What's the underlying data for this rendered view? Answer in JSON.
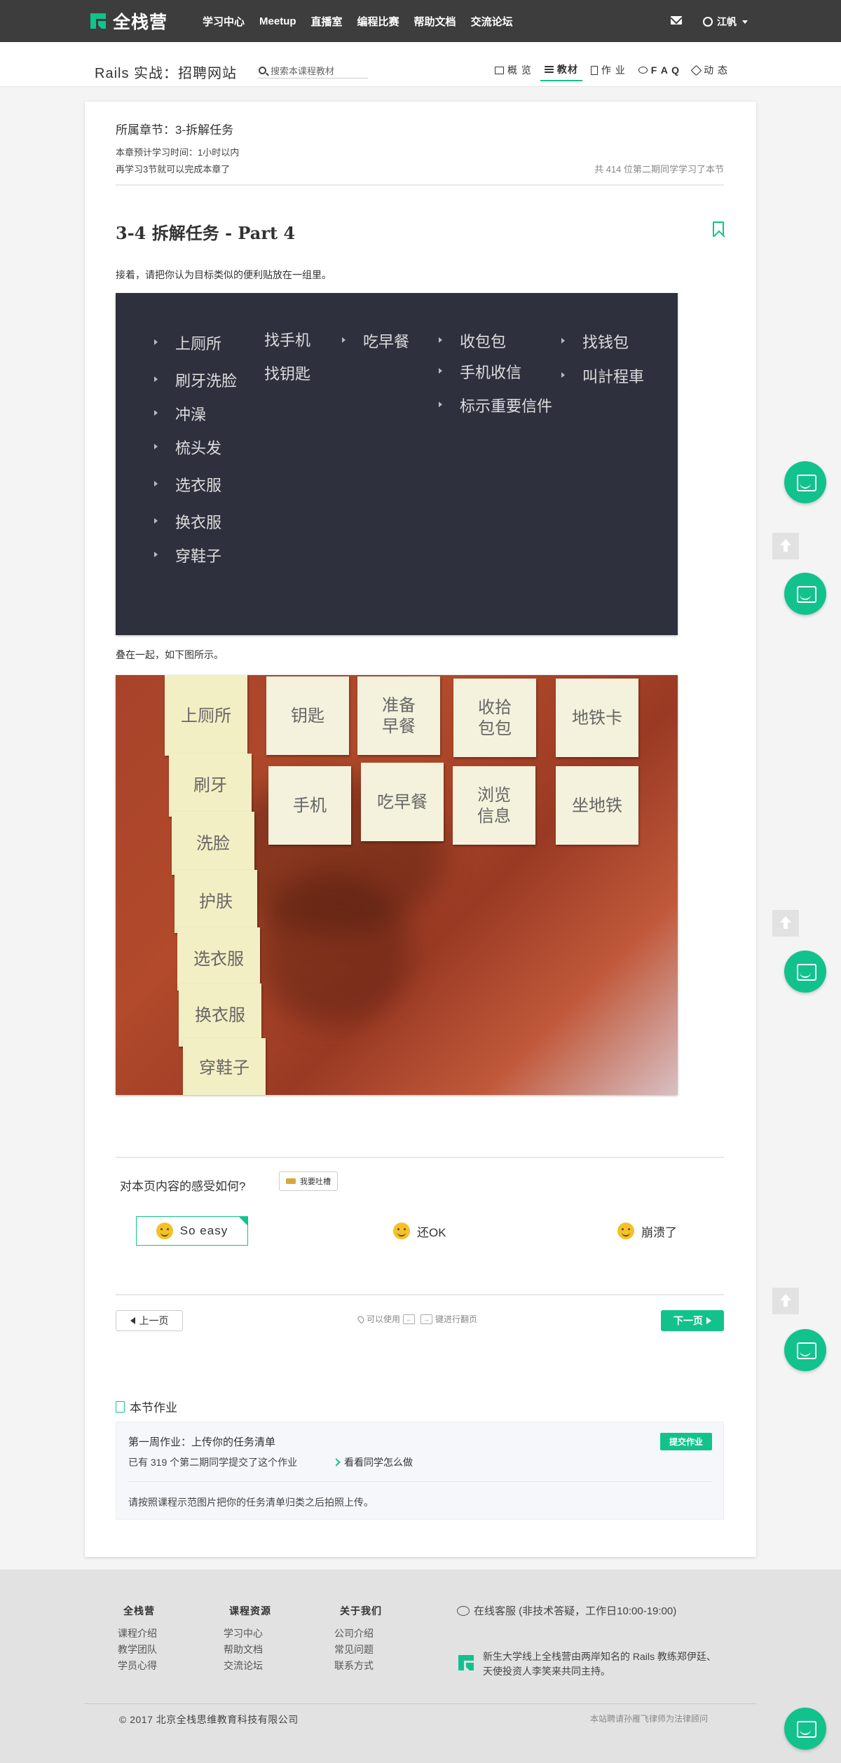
{
  "nav": {
    "brand": "全栈营",
    "links": [
      "学习中心",
      "Meetup",
      "直播室",
      "编程比赛",
      "帮助文档",
      "交流论坛"
    ],
    "user": "江帆",
    "brand_color": "#12c28d"
  },
  "course": {
    "title": "Rails 实战：招聘网站",
    "search_placeholder": "搜索本课程教材",
    "tabs": [
      "概 览",
      "教材",
      "作 业",
      "F A Q",
      "动 态"
    ],
    "active_tab": "教材"
  },
  "chapter": {
    "label": "所属章节：3-拆解任务",
    "time": "本章预计学习时间：1小时以内",
    "remain": "再学习3节就可以完成本章了",
    "count": "共 414 位第二期同学学习了本节"
  },
  "lesson": {
    "title": "3-4 拆解任务 - Part 4",
    "para1": "接着，请把你认为目标类似的便利贴放在一组里。",
    "para2": "叠在一起，如下图所示。"
  },
  "board": {
    "col1": [
      "上厕所",
      "刷牙洗脸",
      "冲澡",
      "梳头发",
      "选衣服",
      "换衣服",
      "穿鞋子"
    ],
    "col2": [
      "找手机",
      "找钥匙"
    ],
    "col3": [
      "吃早餐"
    ],
    "col4": [
      "收包包",
      "手机收信",
      "标示重要信件"
    ],
    "col5": [
      "找钱包",
      "叫計程車"
    ]
  },
  "photo_notes": {
    "column": [
      "上厕所",
      "刷牙",
      "洗脸",
      "护肤",
      "选衣服",
      "换衣服",
      "穿鞋子"
    ],
    "top_row": [
      "钥匙",
      "准备\n早餐",
      "收拾\n包包",
      "地铁卡"
    ],
    "bottom_row": [
      "手机",
      "吃早餐",
      "浏览\n信息",
      "坐地铁"
    ]
  },
  "feedback": {
    "question": "对本页内容的感受如何?",
    "tucao": "我要吐槽",
    "options": [
      "So easy",
      "还OK",
      "崩溃了"
    ],
    "selected": "So easy"
  },
  "pager": {
    "prev": "上一页",
    "hint_prefix": "可以使用",
    "key_left": "←",
    "key_right": "→",
    "hint_suffix": "键进行翻页",
    "next": "下一页"
  },
  "homework": {
    "section_title": "本节作业",
    "name": "第一周作业：上传你的任务清单",
    "count": "已有 319 个第二期同学提交了这个作业",
    "see_others": "看看同学怎么做",
    "submit": "提交作业",
    "desc": "请按照课程示范图片把你的任务清单归类之后拍照上传。"
  },
  "footer": {
    "col1": {
      "title": "全栈营",
      "items": [
        "课程介绍",
        "教学团队",
        "学员心得"
      ]
    },
    "col2": {
      "title": "课程资源",
      "items": [
        "学习中心",
        "帮助文档",
        "交流论坛"
      ]
    },
    "col3": {
      "title": "关于我们",
      "items": [
        "公司介绍",
        "常见问题",
        "联系方式"
      ]
    },
    "service": "在线客服 (非技术答疑，工作日10:00-19:00)",
    "desc": "新生大学线上全栈营由两岸知名的 Rails 教练郑伊廷、天使投资人李笑来共同主持。",
    "copyright": "© 2017 北京全栈思维教育科技有限公司",
    "legal": "本站聘请孙雁飞律师为法律顾问"
  }
}
